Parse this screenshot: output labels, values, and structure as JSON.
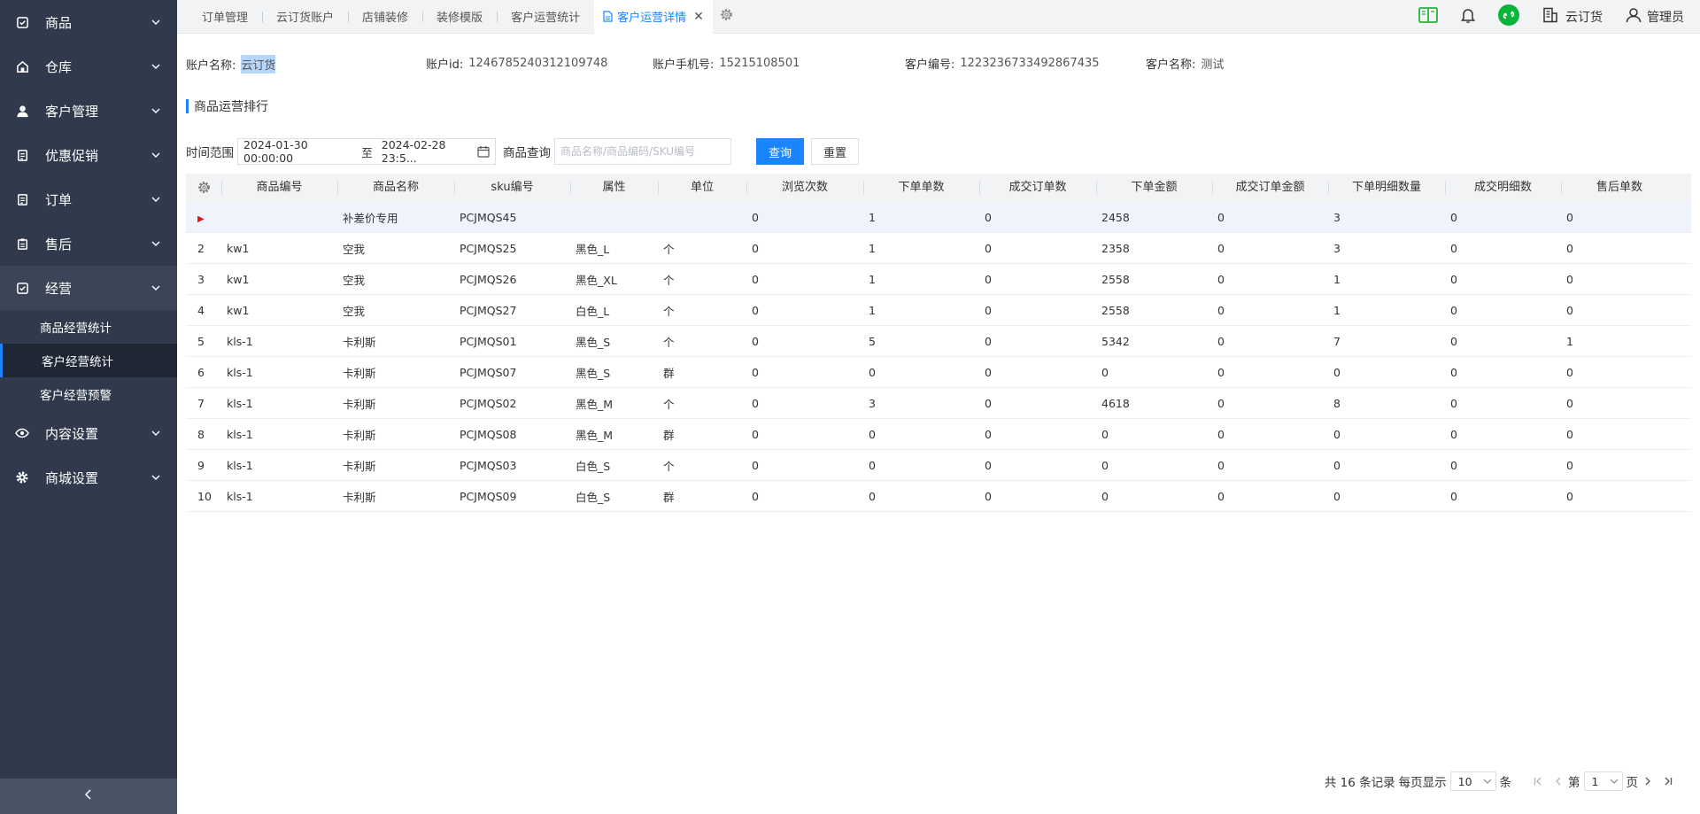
{
  "sidebar": {
    "items": [
      {
        "label": "商品",
        "icon": "product-icon"
      },
      {
        "label": "仓库",
        "icon": "warehouse-icon"
      },
      {
        "label": "客户管理",
        "icon": "user-icon"
      },
      {
        "label": "优惠促销",
        "icon": "promotion-icon"
      },
      {
        "label": "订单",
        "icon": "order-icon"
      },
      {
        "label": "售后",
        "icon": "aftersale-icon"
      },
      {
        "label": "经营",
        "icon": "operation-icon"
      },
      {
        "label": "内容设置",
        "icon": "eye-icon"
      },
      {
        "label": "商城设置",
        "icon": "gear-icon"
      }
    ],
    "submenu": [
      "商品经营统计",
      "客户经营统计",
      "客户经营预警"
    ]
  },
  "tabs": [
    "订单管理",
    "云订货账户",
    "店铺装修",
    "装修模版",
    "客户运营统计",
    "客户运营详情"
  ],
  "topbar": {
    "company": "云订货",
    "user": "管理员"
  },
  "info": {
    "account_name_label": "账户名称:",
    "account_name": "云订货",
    "account_id_label": "账户id:",
    "account_id": "1246785240312109748",
    "phone_label": "账户手机号:",
    "phone": "15215108501",
    "customer_no_label": "客户编号:",
    "customer_no": "1223236733492867435",
    "customer_name_label": "客户名称:",
    "customer_name": "测试"
  },
  "section_title": "商品运营排行",
  "filter": {
    "time_label": "时间范围",
    "start": "2024-01-30 00:00:00",
    "sep": "至",
    "end": "2024-02-28 23:5...",
    "query_label": "商品查询",
    "placeholder": "商品名称/商品编码/SKU编号",
    "search_btn": "查询",
    "reset_btn": "重置"
  },
  "table": {
    "headers": [
      "商品编号",
      "商品名称",
      "sku编号",
      "属性",
      "单位",
      "浏览次数",
      "下单单数",
      "成交订单数",
      "下单金额",
      "成交订单金额",
      "下单明细数量",
      "成交明细数",
      "售后单数"
    ],
    "rows": [
      {
        "idx": "",
        "cells": [
          "",
          "补差价专用",
          "PCJMQS45",
          "",
          "",
          "0",
          "1",
          "0",
          "2458",
          "0",
          "3",
          "0",
          "0"
        ]
      },
      {
        "idx": "2",
        "cells": [
          "kw1",
          "空我",
          "PCJMQS25",
          "黑色_L",
          "个",
          "0",
          "1",
          "0",
          "2358",
          "0",
          "3",
          "0",
          "0"
        ]
      },
      {
        "idx": "3",
        "cells": [
          "kw1",
          "空我",
          "PCJMQS26",
          "黑色_XL",
          "个",
          "0",
          "1",
          "0",
          "2558",
          "0",
          "1",
          "0",
          "0"
        ]
      },
      {
        "idx": "4",
        "cells": [
          "kw1",
          "空我",
          "PCJMQS27",
          "白色_L",
          "个",
          "0",
          "1",
          "0",
          "2558",
          "0",
          "1",
          "0",
          "0"
        ]
      },
      {
        "idx": "5",
        "cells": [
          "kls-1",
          "卡利斯",
          "PCJMQS01",
          "黑色_S",
          "个",
          "0",
          "5",
          "0",
          "5342",
          "0",
          "7",
          "0",
          "1"
        ]
      },
      {
        "idx": "6",
        "cells": [
          "kls-1",
          "卡利斯",
          "PCJMQS07",
          "黑色_S",
          "群",
          "0",
          "0",
          "0",
          "0",
          "0",
          "0",
          "0",
          "0"
        ]
      },
      {
        "idx": "7",
        "cells": [
          "kls-1",
          "卡利斯",
          "PCJMQS02",
          "黑色_M",
          "个",
          "0",
          "3",
          "0",
          "4618",
          "0",
          "8",
          "0",
          "0"
        ]
      },
      {
        "idx": "8",
        "cells": [
          "kls-1",
          "卡利斯",
          "PCJMQS08",
          "黑色_M",
          "群",
          "0",
          "0",
          "0",
          "0",
          "0",
          "0",
          "0",
          "0"
        ]
      },
      {
        "idx": "9",
        "cells": [
          "kls-1",
          "卡利斯",
          "PCJMQS03",
          "白色_S",
          "个",
          "0",
          "0",
          "0",
          "0",
          "0",
          "0",
          "0",
          "0"
        ]
      },
      {
        "idx": "10",
        "cells": [
          "kls-1",
          "卡利斯",
          "PCJMQS09",
          "白色_S",
          "群",
          "0",
          "0",
          "0",
          "0",
          "0",
          "0",
          "0",
          "0"
        ]
      }
    ]
  },
  "pagination": {
    "total_text": "共 16 条记录",
    "per_page_label": "每页显示",
    "per_page": "10",
    "unit": "条",
    "page_prefix": "第",
    "page": "1",
    "page_suffix": "页"
  },
  "colors": {
    "accent": "#1b85ff",
    "sidebar": "#303a4c",
    "row_highlight": "#eef3fc",
    "marker": "#e8141b"
  }
}
